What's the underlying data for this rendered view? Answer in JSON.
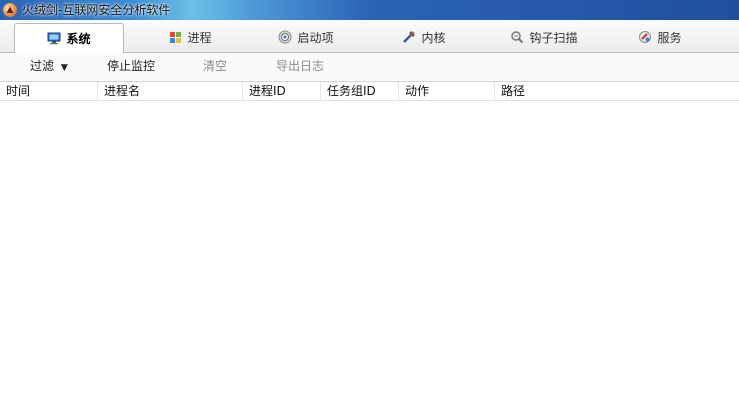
{
  "window": {
    "title": "火绒剑-互联网安全分析软件"
  },
  "tabs": [
    {
      "label": "系统",
      "icon": "monitor-icon",
      "active": true
    },
    {
      "label": "进程",
      "icon": "windows-icon"
    },
    {
      "label": "启动项",
      "icon": "gear-icon"
    },
    {
      "label": "内核",
      "icon": "tools-icon"
    },
    {
      "label": "钩子扫描",
      "icon": "hook-icon"
    },
    {
      "label": "服务",
      "icon": "service-icon"
    }
  ],
  "toolbar": {
    "filter_label": "过滤",
    "stop_monitor_label": "停止监控",
    "clear_label": "清空",
    "export_log_label": "导出日志"
  },
  "table": {
    "columns": [
      "时间",
      "进程名",
      "进程ID",
      "任务组ID",
      "动作",
      "路径"
    ],
    "rows": []
  },
  "colors": {
    "titlebar": "#2b63b6",
    "tab_bar": "#ececec",
    "disabled_text": "#8c8c8c"
  }
}
